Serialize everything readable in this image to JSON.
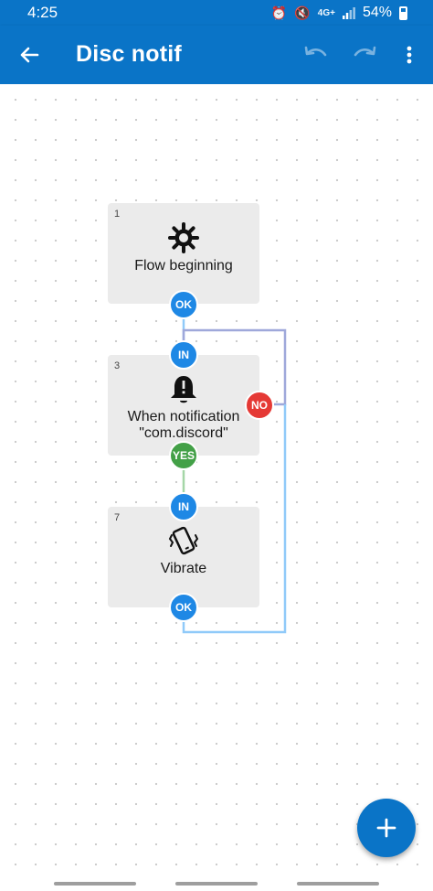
{
  "status_bar": {
    "time": "4:25",
    "network": "4G+",
    "battery": "54%"
  },
  "app_bar": {
    "title": "Disc notif",
    "icons": [
      "back-arrow-icon",
      "undo-icon",
      "redo-icon",
      "more-vert-icon"
    ]
  },
  "flow": {
    "blocks": [
      {
        "number": "1",
        "icon": "gear-icon",
        "label_lines": [
          "Flow beginning"
        ],
        "ports": [
          "OK"
        ]
      },
      {
        "number": "3",
        "icon": "bell-alert-icon",
        "label_lines": [
          "When notification",
          "\"com.discord\""
        ],
        "ports": [
          "IN",
          "NO",
          "YES"
        ]
      },
      {
        "number": "7",
        "icon": "vibrate-phone-icon",
        "label_lines": [
          "Vibrate"
        ],
        "ports": [
          "IN",
          "OK"
        ]
      }
    ]
  },
  "fab": {
    "icon": "plus-icon"
  },
  "colors": {
    "primary": "#0a74c7",
    "port_blue": "#1e88e5",
    "port_no": "#e53935",
    "port_yes": "#43a047",
    "block_bg": "#ebebeb"
  }
}
